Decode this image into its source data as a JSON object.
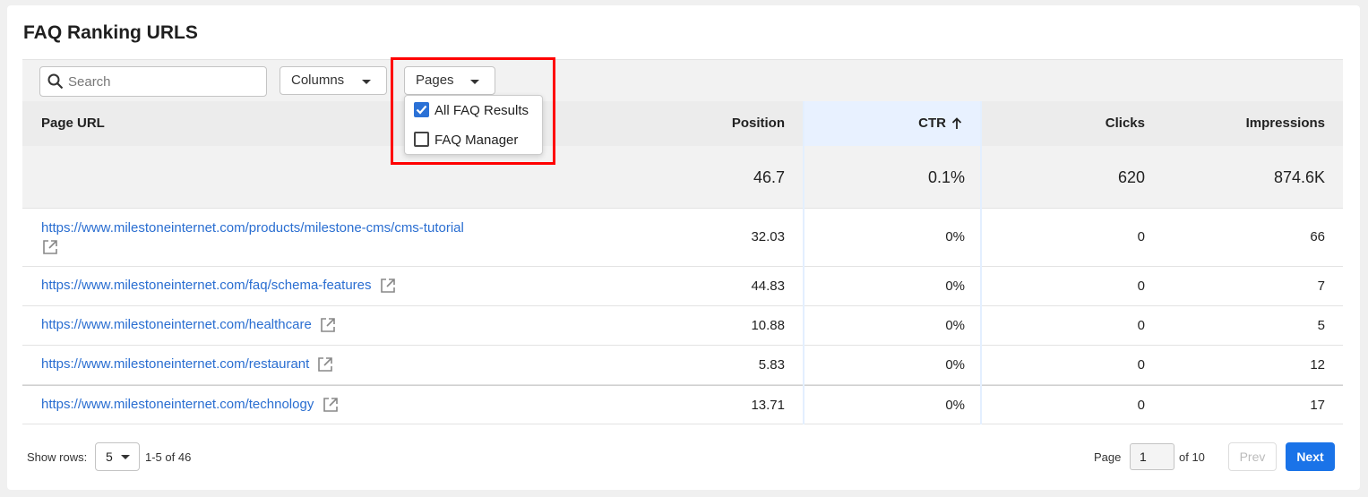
{
  "title": "FAQ Ranking URLS",
  "toolbar": {
    "search_placeholder": "Search",
    "columns_label": "Columns",
    "pages_label": "Pages"
  },
  "pages_menu": {
    "options": [
      {
        "label": "All FAQ Results",
        "checked": true
      },
      {
        "label": "FAQ Manager",
        "checked": false
      }
    ]
  },
  "table": {
    "headers": {
      "url": "Page URL",
      "position": "Position",
      "ctr": "CTR",
      "ctr_sort_icon": "arrow-up-icon",
      "clicks": "Clicks",
      "impressions": "Impressions"
    },
    "totals": {
      "position": "46.7",
      "ctr": "0.1%",
      "clicks": "620",
      "impressions": "874.6K"
    },
    "rows": [
      {
        "url": "https://www.milestoneinternet.com/products/milestone-cms/cms-tutorial",
        "position": "32.03",
        "ctr": "0%",
        "clicks": "0",
        "impressions": "66"
      },
      {
        "url": "https://www.milestoneinternet.com/faq/schema-features",
        "position": "44.83",
        "ctr": "0%",
        "clicks": "0",
        "impressions": "7"
      },
      {
        "url": "https://www.milestoneinternet.com/healthcare",
        "position": "10.88",
        "ctr": "0%",
        "clicks": "0",
        "impressions": "5"
      },
      {
        "url": "https://www.milestoneinternet.com/restaurant",
        "position": "5.83",
        "ctr": "0%",
        "clicks": "0",
        "impressions": "12"
      },
      {
        "url": "https://www.milestoneinternet.com/technology",
        "position": "13.71",
        "ctr": "0%",
        "clicks": "0",
        "impressions": "17"
      }
    ]
  },
  "footer": {
    "show_rows_label": "Show rows:",
    "rows_value": "5",
    "range": "1-5 of 46",
    "page_label": "Page",
    "page_value": "1",
    "of_pages": "of 10",
    "prev_label": "Prev",
    "next_label": "Next"
  },
  "colors": {
    "link": "#2a6ed1",
    "primary_button": "#1a73e8",
    "highlight_box": "#ff0000"
  }
}
